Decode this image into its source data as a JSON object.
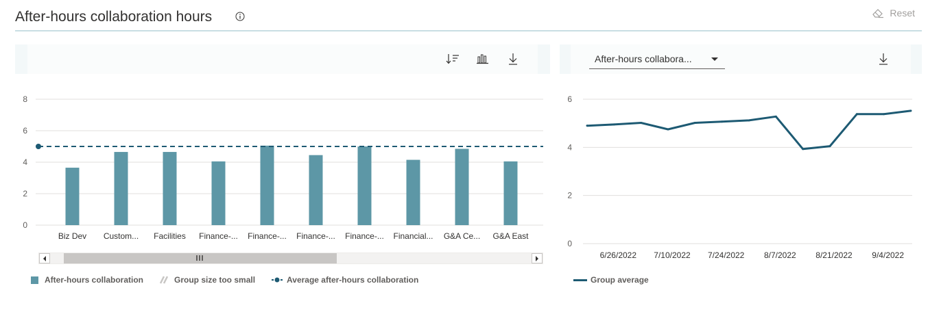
{
  "header": {
    "title": "After-hours collaboration hours",
    "info_icon": "info-icon",
    "reset_label": "Reset",
    "reset_icon": "eraser-icon"
  },
  "left_toolbar": {
    "icons": [
      "sort-icon",
      "bar-chart-icon",
      "download-icon"
    ]
  },
  "right_toolbar": {
    "dropdown_value": "After-hours collabora...",
    "icons": [
      "chevron-down-icon",
      "download-icon"
    ]
  },
  "colors": {
    "bar": "#5d97a6",
    "average_line": "#1d5a73",
    "trend_line": "#1d5a73",
    "grid": "#e1dfdd",
    "header_rule": "#c8dee3"
  },
  "chart_data": [
    {
      "type": "bar",
      "categories": [
        "Biz Dev",
        "Custom...",
        "Facilities",
        "Finance-...",
        "Finance-...",
        "Finance-...",
        "Finance-...",
        "Financial...",
        "G&A Ce...",
        "G&A East"
      ],
      "series": [
        {
          "name": "After-hours collaboration",
          "values": [
            3.65,
            4.65,
            4.65,
            4.05,
            5.05,
            4.45,
            5.0,
            4.15,
            4.85,
            4.05
          ]
        }
      ],
      "average": {
        "name": "Average after-hours collaboration",
        "value": 5.0
      },
      "ylim": [
        0,
        8
      ],
      "yticks": [
        0,
        2,
        4,
        6,
        8
      ],
      "grid": true,
      "legend": {
        "position": "bottom-left",
        "entries": [
          "After-hours collaboration",
          "Group size too small",
          "Average after-hours collaboration"
        ]
      }
    },
    {
      "type": "line",
      "x": [
        "6/19/2022",
        "6/26/2022",
        "7/3/2022",
        "7/10/2022",
        "7/17/2022",
        "7/24/2022",
        "7/31/2022",
        "8/7/2022",
        "8/14/2022",
        "8/21/2022",
        "8/28/2022",
        "9/4/2022",
        "9/11/2022"
      ],
      "xticks": [
        "6/26/2022",
        "7/10/2022",
        "7/24/2022",
        "8/7/2022",
        "8/21/2022",
        "9/4/2022"
      ],
      "series": [
        {
          "name": "Group average",
          "values": [
            4.9,
            4.95,
            5.02,
            4.75,
            5.02,
            5.07,
            5.12,
            5.28,
            3.93,
            4.05,
            5.38,
            5.38,
            5.52
          ]
        }
      ],
      "ylim": [
        0,
        6
      ],
      "yticks": [
        0,
        2,
        4,
        6
      ],
      "grid": true,
      "legend": {
        "position": "bottom-left",
        "entries": [
          "Group average"
        ]
      }
    }
  ]
}
